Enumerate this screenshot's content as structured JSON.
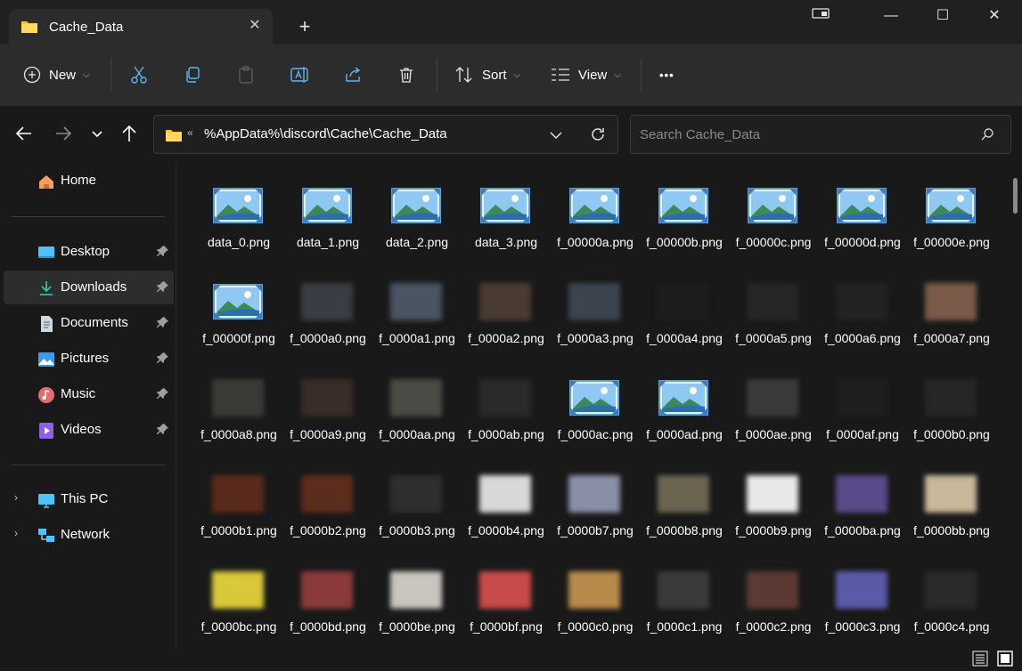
{
  "tab": {
    "title": "Cache_Data",
    "close_icon": "close-icon",
    "new_tab_icon": "plus-icon"
  },
  "window_controls": {
    "minimize": "—",
    "maximize": "☐",
    "close": "✕"
  },
  "toolbar": {
    "new_label": "New",
    "sort_label": "Sort",
    "view_label": "View",
    "more_label": "•••"
  },
  "address": {
    "overflow": "«",
    "path": "%AppData%\\discord\\Cache\\Cache_Data"
  },
  "search": {
    "placeholder": "Search Cache_Data"
  },
  "sidebar": {
    "home": "Home",
    "quick_access": [
      {
        "label": "Desktop",
        "icon": "desktop-icon",
        "color": "#4cc2ff"
      },
      {
        "label": "Downloads",
        "icon": "download-icon",
        "color": "#2fbfa6"
      },
      {
        "label": "Documents",
        "icon": "document-icon",
        "color": "#cfd8e3"
      },
      {
        "label": "Pictures",
        "icon": "pictures-icon",
        "color": "#3d9be9"
      },
      {
        "label": "Music",
        "icon": "music-icon",
        "color": "#e06c6c"
      },
      {
        "label": "Videos",
        "icon": "video-icon",
        "color": "#8f5fe8"
      }
    ],
    "this_pc": "This PC",
    "network": "Network"
  },
  "files": [
    {
      "name": "data_0.png",
      "thumb": "image-icon"
    },
    {
      "name": "data_1.png",
      "thumb": "image-icon"
    },
    {
      "name": "data_2.png",
      "thumb": "image-icon"
    },
    {
      "name": "data_3.png",
      "thumb": "image-icon"
    },
    {
      "name": "f_00000a.png",
      "thumb": "image-icon"
    },
    {
      "name": "f_00000b.png",
      "thumb": "image-icon"
    },
    {
      "name": "f_00000c.png",
      "thumb": "image-icon"
    },
    {
      "name": "f_00000d.png",
      "thumb": "image-icon"
    },
    {
      "name": "f_00000e.png",
      "thumb": "image-icon"
    },
    {
      "name": "f_00000f.png",
      "thumb": "image-icon"
    },
    {
      "name": "f_0000a0.png",
      "thumb": "blur",
      "color": "#3a3d44"
    },
    {
      "name": "f_0000a1.png",
      "thumb": "blur",
      "color": "#4a5462"
    },
    {
      "name": "f_0000a2.png",
      "thumb": "blur",
      "color": "#4a3a34"
    },
    {
      "name": "f_0000a3.png",
      "thumb": "blur",
      "color": "#3c4450"
    },
    {
      "name": "f_0000a4.png",
      "thumb": "blur",
      "color": "#1c1c1c"
    },
    {
      "name": "f_0000a5.png",
      "thumb": "blur",
      "color": "#262626"
    },
    {
      "name": "f_0000a6.png",
      "thumb": "blur",
      "color": "#222222"
    },
    {
      "name": "f_0000a7.png",
      "thumb": "blur",
      "color": "#7a5a48"
    },
    {
      "name": "f_0000a8.png",
      "thumb": "blur",
      "color": "#3c3a36"
    },
    {
      "name": "f_0000a9.png",
      "thumb": "blur",
      "color": "#3a2c26"
    },
    {
      "name": "f_0000aa.png",
      "thumb": "blur",
      "color": "#4b4a44"
    },
    {
      "name": "f_0000ab.png",
      "thumb": "blur",
      "color": "#2a2a2a"
    },
    {
      "name": "f_0000ac.png",
      "thumb": "image-icon"
    },
    {
      "name": "f_0000ad.png",
      "thumb": "image-icon"
    },
    {
      "name": "f_0000ae.png",
      "thumb": "blur",
      "color": "#3a3a3a"
    },
    {
      "name": "f_0000af.png",
      "thumb": "blur",
      "color": "#1e1e1e"
    },
    {
      "name": "f_0000b0.png",
      "thumb": "blur",
      "color": "#262626"
    },
    {
      "name": "f_0000b1.png",
      "thumb": "blur",
      "color": "#5a2a1a"
    },
    {
      "name": "f_0000b2.png",
      "thumb": "blur",
      "color": "#5c2c1c"
    },
    {
      "name": "f_0000b3.png",
      "thumb": "blur",
      "color": "#2e2e2e"
    },
    {
      "name": "f_0000b4.png",
      "thumb": "blur",
      "color": "#d8d8d8"
    },
    {
      "name": "f_0000b7.png",
      "thumb": "blur",
      "color": "#8a8fa8"
    },
    {
      "name": "f_0000b8.png",
      "thumb": "blur",
      "color": "#6a6450"
    },
    {
      "name": "f_0000b9.png",
      "thumb": "blur",
      "color": "#e8e8e8"
    },
    {
      "name": "f_0000ba.png",
      "thumb": "blur",
      "color": "#5a4a8a"
    },
    {
      "name": "f_0000bb.png",
      "thumb": "blur",
      "color": "#c8b89a"
    },
    {
      "name": "f_0000bc.png",
      "thumb": "blur",
      "color": "#d8c83a"
    },
    {
      "name": "f_0000bd.png",
      "thumb": "blur",
      "color": "#8a3a3a"
    },
    {
      "name": "f_0000be.png",
      "thumb": "blur",
      "color": "#c8c4be"
    },
    {
      "name": "f_0000bf.png",
      "thumb": "blur",
      "color": "#c84a4a"
    },
    {
      "name": "f_0000c0.png",
      "thumb": "blur",
      "color": "#b88a4a"
    },
    {
      "name": "f_0000c1.png",
      "thumb": "blur",
      "color": "#3a3a3a"
    },
    {
      "name": "f_0000c2.png",
      "thumb": "blur",
      "color": "#5a3a32"
    },
    {
      "name": "f_0000c3.png",
      "thumb": "blur",
      "color": "#5a5aa8"
    },
    {
      "name": "f_0000c4.png",
      "thumb": "blur",
      "color": "#2a2a2a"
    }
  ],
  "status": {
    "details_view_icon": "details-view-icon",
    "tiles_view_icon": "large-icons-view-icon"
  }
}
